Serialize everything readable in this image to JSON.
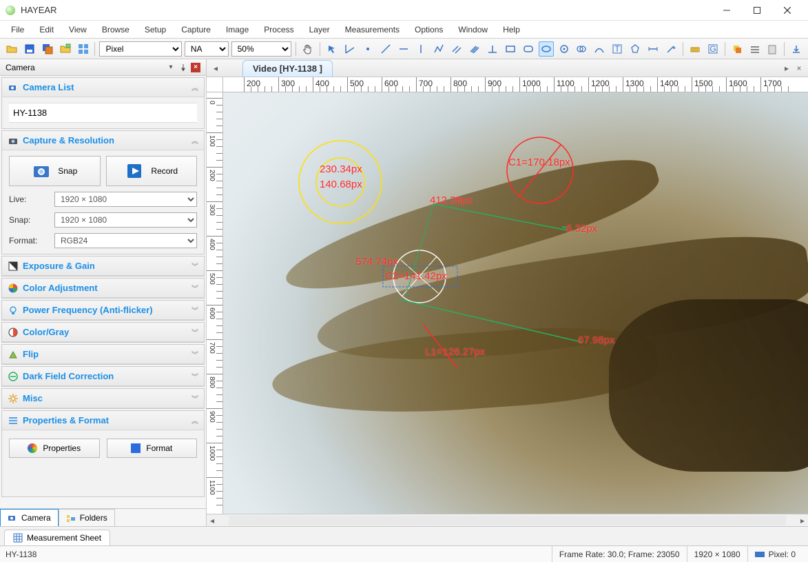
{
  "app": {
    "title": "HAYEAR"
  },
  "menu": {
    "items": [
      "File",
      "Edit",
      "View",
      "Browse",
      "Setup",
      "Capture",
      "Image",
      "Process",
      "Layer",
      "Measurements",
      "Options",
      "Window",
      "Help"
    ]
  },
  "toolbar": {
    "unit_select": "Pixel",
    "na_select": "NA",
    "zoom_select": "50%"
  },
  "sidebar": {
    "panel_title": "Camera",
    "sections": {
      "camera_list": {
        "title": "Camera List",
        "item": "HY-1138"
      },
      "capture_res": {
        "title": "Capture & Resolution",
        "snap_label": "Snap",
        "record_label": "Record",
        "live_label": "Live:",
        "live_value": "1920 × 1080",
        "snaplbl": "Snap:",
        "snap_value": "1920 × 1080",
        "format_label": "Format:",
        "format_value": "RGB24"
      },
      "exposure": {
        "title": "Exposure & Gain"
      },
      "color_adj": {
        "title": "Color Adjustment"
      },
      "power_freq": {
        "title": "Power Frequency (Anti-flicker)"
      },
      "color_gray": {
        "title": "Color/Gray"
      },
      "flip": {
        "title": "Flip"
      },
      "darkfield": {
        "title": "Dark Field Correction"
      },
      "misc": {
        "title": "Misc"
      },
      "props_format": {
        "title": "Properties & Format",
        "properties_btn": "Properties",
        "format_btn": "Format"
      }
    },
    "tabs": {
      "camera": "Camera",
      "folders": "Folders"
    }
  },
  "content": {
    "tab_label": "Video [HY-1138 ]",
    "ruler_h": [
      "200",
      "300",
      "400",
      "500",
      "600",
      "700",
      "800",
      "900",
      "1000",
      "1100",
      "1200",
      "1300",
      "1400",
      "1500",
      "1600",
      "1700"
    ],
    "ruler_v": [
      "0",
      "100",
      "200",
      "300",
      "400",
      "500",
      "600",
      "700",
      "800",
      "900",
      "1000",
      "1100"
    ]
  },
  "measurements": {
    "m1": "230.34px",
    "m2": "140.68px",
    "m3": "412.38px",
    "m4": "C1=170.18px",
    "m5": "574.74px",
    "m6": "C2=141.42px",
    "m7": "6.32px",
    "m8": "67.98px",
    "m9": "L1=126.27px"
  },
  "bottom_tabs": {
    "measurement_sheet": "Measurement Sheet"
  },
  "status": {
    "device": "HY-1138",
    "frame": "Frame Rate: 30.0; Frame: 23050",
    "res": "1920 × 1080",
    "pixel": "Pixel: 0"
  }
}
